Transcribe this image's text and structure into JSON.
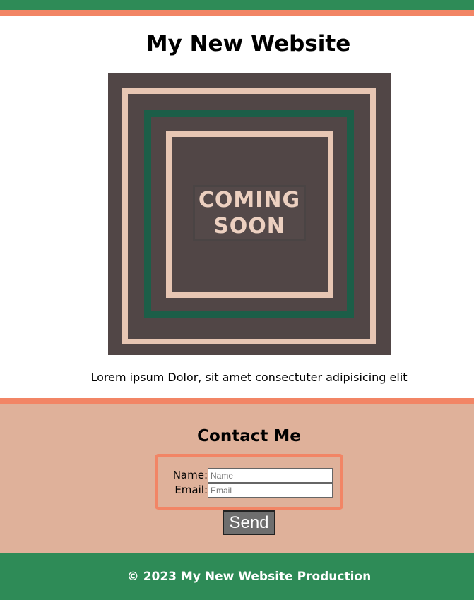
{
  "header": {
    "title": "My New Website"
  },
  "hero": {
    "badge_line1": "COMING",
    "badge_line2": "SOON"
  },
  "intro": {
    "text": "Lorem ipsum Dolor, sit amet consectuter adipisicing elit"
  },
  "contact": {
    "title": "Contact Me",
    "name_label": "Name:",
    "name_placeholder": "Name",
    "name_value": "",
    "email_label": "Email:",
    "email_placeholder": "Email",
    "email_value": "",
    "send_label": "Send"
  },
  "footer": {
    "text": "© 2023 My New Website Production"
  },
  "colors": {
    "header_green": "#2e8b57",
    "accent_coral": "#f28565",
    "contact_bg": "#dfb19a",
    "hero_bg": "#514646",
    "hero_frame_light": "#e7c6b3",
    "hero_frame_green": "#1c5e48"
  }
}
